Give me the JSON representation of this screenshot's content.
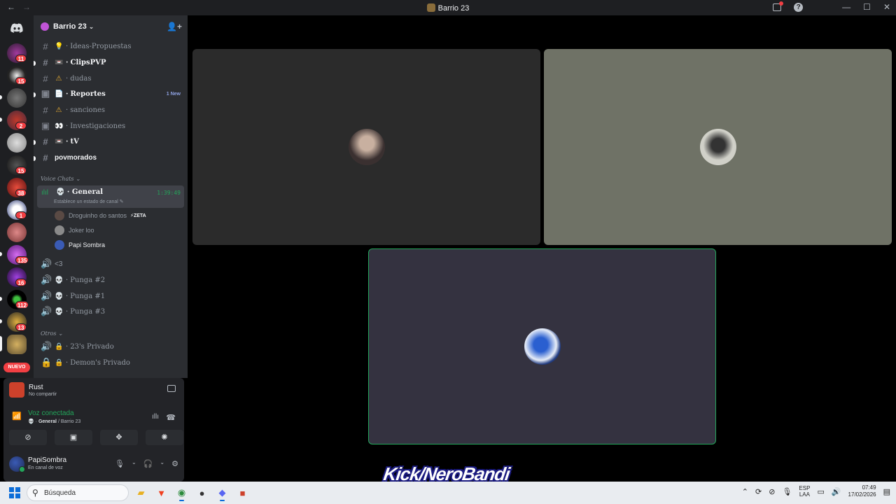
{
  "window": {
    "title": "Barrio 23",
    "back": "←",
    "forward": "→",
    "help": "?",
    "minimize": "—",
    "maximize": "☐",
    "close": "✕"
  },
  "server_list": {
    "badges": [
      "11",
      "15",
      "2",
      "15",
      "38",
      "1",
      "135",
      "16",
      "112",
      "13"
    ],
    "new_label": "NUEVO"
  },
  "guild": {
    "name": "Barrio 23",
    "channels": [
      {
        "name": "Ideas-Propuestas",
        "emoji": "💡"
      },
      {
        "name": "ClipsPVP",
        "emoji": "📼"
      },
      {
        "name": "dudas",
        "emoji": "⚠"
      },
      {
        "name": "Reportes",
        "emoji": "📄",
        "tag": "1 New"
      },
      {
        "name": "sanciones",
        "emoji": "⚠"
      },
      {
        "name": "Investigaciones",
        "emoji": "👀"
      },
      {
        "name": "tV",
        "emoji": "📼"
      },
      {
        "name": "povmorados",
        "emoji": ""
      }
    ],
    "voice_category": "Voice Chats",
    "active_voice": {
      "name": "General",
      "time": "1:39:49",
      "status": "Establece un estado de canal"
    },
    "members": [
      {
        "name": "Droguinho do santos",
        "tag": "⚡ZETA"
      },
      {
        "name": "Joker loo"
      },
      {
        "name": "Papi Sombra"
      }
    ],
    "voice_channels": [
      "<3",
      "Punga #2",
      "Punga #1",
      "Punga #3"
    ],
    "other_category": "Otros",
    "other_channels": [
      "23's Privado",
      "Demon's Privado"
    ]
  },
  "activity": {
    "game": "Rust",
    "share_status": "No compartir"
  },
  "voice_panel": {
    "status": "Voz conectada",
    "channel": "General",
    "server": "Barrio 23"
  },
  "user": {
    "name": "PapiSombra",
    "status": "En canal de voz"
  },
  "overlay": {
    "text": "Kick/NeroBandi"
  },
  "taskbar": {
    "search_placeholder": "Búsqueda",
    "lang_top": "ESP",
    "lang_bottom": "LAA",
    "time": "07:49",
    "date": "17/02/2026"
  }
}
